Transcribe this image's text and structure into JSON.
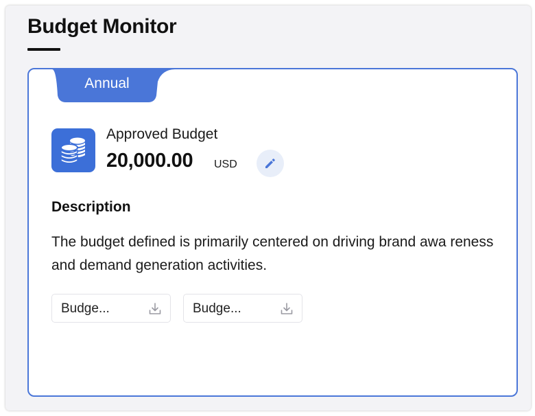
{
  "page": {
    "title": "Budget Monitor"
  },
  "card": {
    "tab_label": "Annual",
    "approved_label": "Approved Budget",
    "amount": "20,000.00",
    "currency": "USD",
    "description_heading": "Description",
    "description_text": "The budget defined is primarily centered on driving brand awa reness and demand generation activities.",
    "attachments": [
      {
        "name": "Budge..."
      },
      {
        "name": "Budge..."
      }
    ]
  },
  "colors": {
    "accent": "#4a76d8",
    "icon_bg": "#3c6fd8",
    "edit_bg": "#e8eef9"
  },
  "icons": {
    "budget": "coins-stack-icon",
    "edit": "pencil-icon",
    "download": "download-icon"
  }
}
